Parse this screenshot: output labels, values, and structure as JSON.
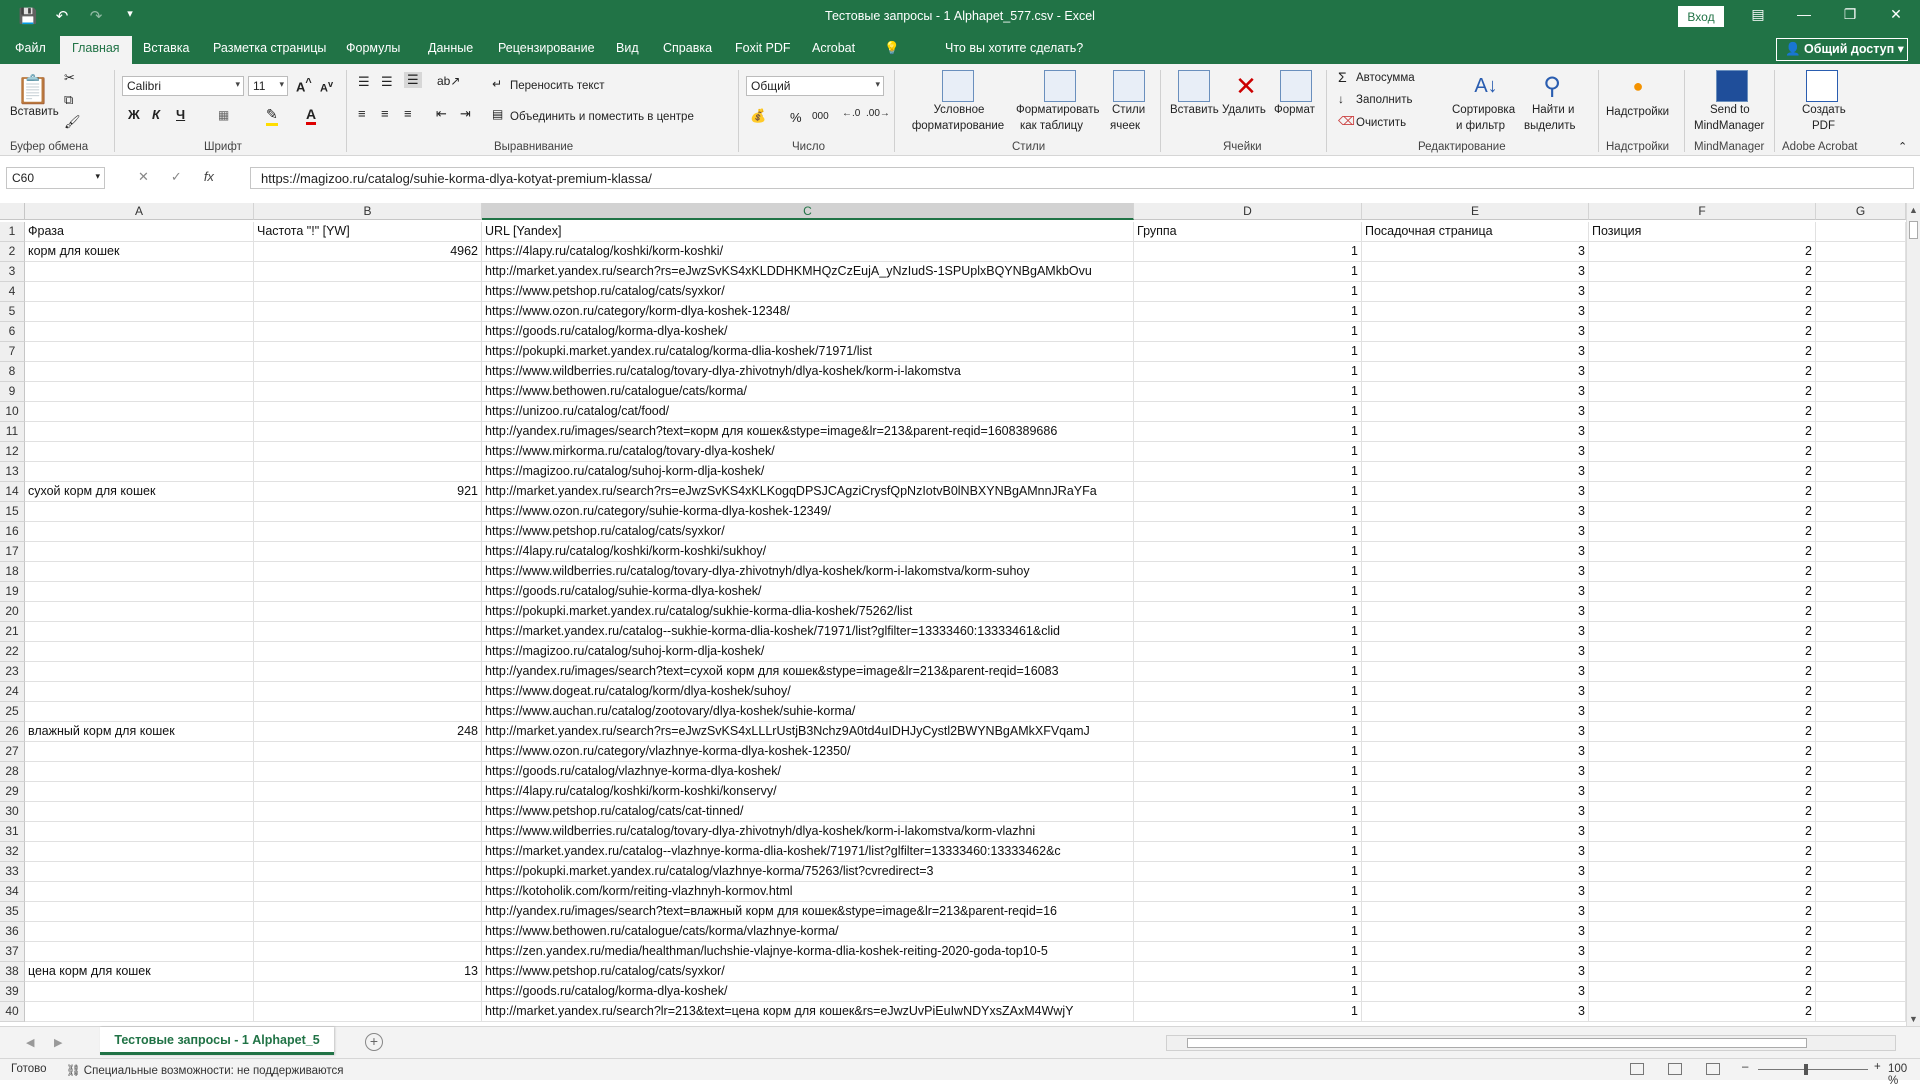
{
  "titlebar": {
    "title": "Тестовые запросы - 1 Alphapet_577.csv  -  Excel",
    "signin": "Вход",
    "qat_icons": [
      "save-icon",
      "undo-icon",
      "redo-icon",
      "customize-icon"
    ]
  },
  "tabs": [
    "Файл",
    "Главная",
    "Вставка",
    "Разметка страницы",
    "Формулы",
    "Данные",
    "Рецензирование",
    "Вид",
    "Справка",
    "Foxit PDF",
    "Acrobat"
  ],
  "tell_me": "Что вы хотите сделать?",
  "share": "Общий доступ",
  "ribbon": {
    "clipboard": {
      "paste": "Вставить",
      "label": "Буфер обмена"
    },
    "font": {
      "name": "Calibri",
      "size": "11",
      "label": "Шрифт",
      "bold": "Ж",
      "italic": "К",
      "underline": "Ч"
    },
    "alignment": {
      "wrap": "Переносить текст",
      "merge": "Объединить и поместить в центре",
      "label": "Выравнивание"
    },
    "number": {
      "format": "Общий",
      "label": "Число",
      "percent": "%",
      "thousands": "000"
    },
    "styles": {
      "conditional": [
        "Условное",
        "форматирование"
      ],
      "as_table": [
        "Форматировать",
        "как таблицу"
      ],
      "cell_styles": [
        "Стили",
        "ячеек"
      ],
      "label": "Стили"
    },
    "cells": {
      "insert": "Вставить",
      "delete": "Удалить",
      "format": "Формат",
      "label": "Ячейки"
    },
    "editing": {
      "autosum": "Автосумма",
      "fill": "Заполнить",
      "clear": "Очистить",
      "sort": [
        "Сортировка",
        "и фильтр"
      ],
      "find": [
        "Найти и",
        "выделить"
      ],
      "label": "Редактирование"
    },
    "addins": {
      "button": "Надстройки",
      "label": "Надстройки"
    },
    "mindmanager": {
      "button": [
        "Send to",
        "MindManager"
      ],
      "label": "MindManager"
    },
    "acrobat": {
      "button": [
        "Создать",
        "PDF"
      ],
      "label": "Adobe Acrobat"
    }
  },
  "formula_bar": {
    "name_box": "C60",
    "cancel": "✕",
    "enter": "✓",
    "fx": "fx",
    "value": "https://magizoo.ru/catalog/suhie-korma-dlya-kotyat-premium-klassa/"
  },
  "columns": [
    "A",
    "B",
    "C",
    "D",
    "E",
    "F",
    "G"
  ],
  "header_row": [
    "Фраза",
    "Частота \"!\" [YW]",
    "URL [Yandex]",
    "Группа",
    "Посадочная страница",
    "Позиция"
  ],
  "rows": [
    [
      "корм для кошек",
      "4962",
      "https://4lapy.ru/catalog/koshki/korm-koshki/",
      "1",
      "3",
      "2"
    ],
    [
      "",
      "",
      "http://market.yandex.ru/search?rs=eJwzSvKS4xKLDDHKMHQzCzEujA_yNzIudS-1SPUplxBQYNBgAMkbOvu",
      "1",
      "3",
      "2"
    ],
    [
      "",
      "",
      "https://www.petshop.ru/catalog/cats/syxkor/",
      "1",
      "3",
      "2"
    ],
    [
      "",
      "",
      "https://www.ozon.ru/category/korm-dlya-koshek-12348/",
      "1",
      "3",
      "2"
    ],
    [
      "",
      "",
      "https://goods.ru/catalog/korma-dlya-koshek/",
      "1",
      "3",
      "2"
    ],
    [
      "",
      "",
      "https://pokupki.market.yandex.ru/catalog/korma-dlia-koshek/71971/list",
      "1",
      "3",
      "2"
    ],
    [
      "",
      "",
      "https://www.wildberries.ru/catalog/tovary-dlya-zhivotnyh/dlya-koshek/korm-i-lakomstva",
      "1",
      "3",
      "2"
    ],
    [
      "",
      "",
      "https://www.bethowen.ru/catalogue/cats/korma/",
      "1",
      "3",
      "2"
    ],
    [
      "",
      "",
      "https://unizoo.ru/catalog/cat/food/",
      "1",
      "3",
      "2"
    ],
    [
      "",
      "",
      "http://yandex.ru/images/search?text=корм для кошек&stype=image&lr=213&parent-reqid=1608389686",
      "1",
      "3",
      "2"
    ],
    [
      "",
      "",
      "https://www.mirkorma.ru/catalog/tovary-dlya-koshek/",
      "1",
      "3",
      "2"
    ],
    [
      "",
      "",
      "https://magizoo.ru/catalog/suhoj-korm-dlja-koshek/",
      "1",
      "3",
      "2"
    ],
    [
      "сухой корм для кошек",
      "921",
      "http://market.yandex.ru/search?rs=eJwzSvKS4xKLKogqDPSJCAgziCrysfQpNzIotvB0lNBXYNBgAMnnJRaYFa",
      "1",
      "3",
      "2"
    ],
    [
      "",
      "",
      "https://www.ozon.ru/category/suhie-korma-dlya-koshek-12349/",
      "1",
      "3",
      "2"
    ],
    [
      "",
      "",
      "https://www.petshop.ru/catalog/cats/syxkor/",
      "1",
      "3",
      "2"
    ],
    [
      "",
      "",
      "https://4lapy.ru/catalog/koshki/korm-koshki/sukhoy/",
      "1",
      "3",
      "2"
    ],
    [
      "",
      "",
      "https://www.wildberries.ru/catalog/tovary-dlya-zhivotnyh/dlya-koshek/korm-i-lakomstva/korm-suhoy",
      "1",
      "3",
      "2"
    ],
    [
      "",
      "",
      "https://goods.ru/catalog/suhie-korma-dlya-koshek/",
      "1",
      "3",
      "2"
    ],
    [
      "",
      "",
      "https://pokupki.market.yandex.ru/catalog/sukhie-korma-dlia-koshek/75262/list",
      "1",
      "3",
      "2"
    ],
    [
      "",
      "",
      "https://market.yandex.ru/catalog--sukhie-korma-dlia-koshek/71971/list?glfilter=13333460:13333461&clid",
      "1",
      "3",
      "2"
    ],
    [
      "",
      "",
      "https://magizoo.ru/catalog/suhoj-korm-dlja-koshek/",
      "1",
      "3",
      "2"
    ],
    [
      "",
      "",
      "http://yandex.ru/images/search?text=сухой корм для кошек&stype=image&lr=213&parent-reqid=16083",
      "1",
      "3",
      "2"
    ],
    [
      "",
      "",
      "https://www.dogeat.ru/catalog/korm/dlya-koshek/suhoy/",
      "1",
      "3",
      "2"
    ],
    [
      "",
      "",
      "https://www.auchan.ru/catalog/zootovary/dlya-koshek/suhie-korma/",
      "1",
      "3",
      "2"
    ],
    [
      "влажный корм для кошек",
      "248",
      "http://market.yandex.ru/search?rs=eJwzSvKS4xLLLrUstjB3Nchz9A0td4uIDHJyCystl2BWYNBgAMkXFVqamJ",
      "1",
      "3",
      "2"
    ],
    [
      "",
      "",
      "https://www.ozon.ru/category/vlazhnye-korma-dlya-koshek-12350/",
      "1",
      "3",
      "2"
    ],
    [
      "",
      "",
      "https://goods.ru/catalog/vlazhnye-korma-dlya-koshek/",
      "1",
      "3",
      "2"
    ],
    [
      "",
      "",
      "https://4lapy.ru/catalog/koshki/korm-koshki/konservy/",
      "1",
      "3",
      "2"
    ],
    [
      "",
      "",
      "https://www.petshop.ru/catalog/cats/cat-tinned/",
      "1",
      "3",
      "2"
    ],
    [
      "",
      "",
      "https://www.wildberries.ru/catalog/tovary-dlya-zhivotnyh/dlya-koshek/korm-i-lakomstva/korm-vlazhni",
      "1",
      "3",
      "2"
    ],
    [
      "",
      "",
      "https://market.yandex.ru/catalog--vlazhnye-korma-dlia-koshek/71971/list?glfilter=13333460:13333462&c",
      "1",
      "3",
      "2"
    ],
    [
      "",
      "",
      "https://pokupki.market.yandex.ru/catalog/vlazhnye-korma/75263/list?cvredirect=3",
      "1",
      "3",
      "2"
    ],
    [
      "",
      "",
      "https://kotoholik.com/korm/reiting-vlazhnyh-kormov.html",
      "1",
      "3",
      "2"
    ],
    [
      "",
      "",
      "http://yandex.ru/images/search?text=влажный корм для кошек&stype=image&lr=213&parent-reqid=16",
      "1",
      "3",
      "2"
    ],
    [
      "",
      "",
      "https://www.bethowen.ru/catalogue/cats/korma/vlazhnye-korma/",
      "1",
      "3",
      "2"
    ],
    [
      "",
      "",
      "https://zen.yandex.ru/media/healthman/luchshie-vlajnye-korma-dlia-koshek-reiting-2020-goda-top10-5",
      "1",
      "3",
      "2"
    ],
    [
      "цена корм для кошек",
      "13",
      "https://www.petshop.ru/catalog/cats/syxkor/",
      "1",
      "3",
      "2"
    ],
    [
      "",
      "",
      "https://goods.ru/catalog/korma-dlya-koshek/",
      "1",
      "3",
      "2"
    ],
    [
      "",
      "",
      "http://market.yandex.ru/search?lr=213&text=цена корм для кошек&rs=eJwzUvPiEuIwNDYxsZAxM4WwjY",
      "1",
      "3",
      "2"
    ]
  ],
  "sheet_tab": "Тестовые запросы - 1 Alphapet_5",
  "status": {
    "ready": "Готово",
    "accessibility": "Специальные возможности: не поддерживаются",
    "zoom": "100 %"
  }
}
